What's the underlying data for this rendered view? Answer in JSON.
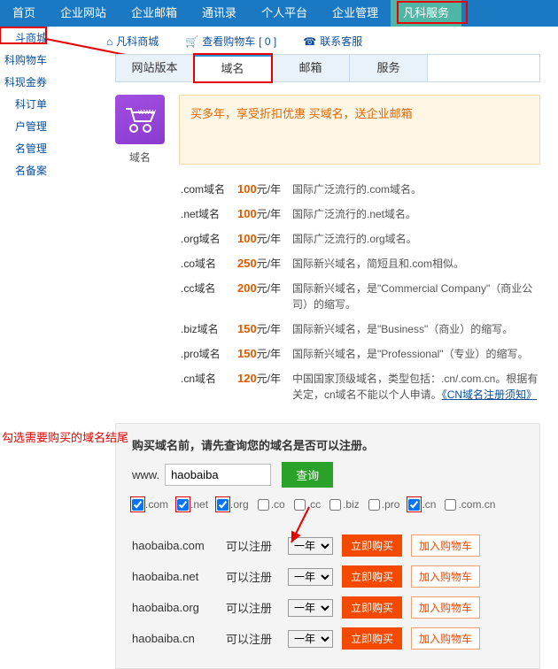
{
  "topnav": {
    "items": [
      "首页",
      "企业网站",
      "企业邮箱",
      "通讯录",
      "个人平台",
      "企业管理",
      "凡科服务"
    ],
    "active_index": 6
  },
  "sidebar": {
    "items": [
      "斗商城",
      "科购物车",
      "科现金券",
      "科订单",
      "户管理",
      "名管理",
      "名备案"
    ],
    "highlight_index": 0
  },
  "subnav": {
    "mall": "凡科商城",
    "cart": "查看购物车",
    "cart_count": "[ 0 ]",
    "service": "联系客服"
  },
  "tabs": {
    "items": [
      "网站版本",
      "域名",
      "邮箱",
      "服务"
    ],
    "active_index": 1
  },
  "domain_icon_label": "域名",
  "promo": "买多年，享受折扣优惠 买域名，送企业邮箱",
  "prices": [
    {
      "ext": ".com域名",
      "price": "100",
      "unit": "元/年",
      "desc": "国际广泛流行的.com域名。"
    },
    {
      "ext": ".net域名",
      "price": "100",
      "unit": "元/年",
      "desc": "国际广泛流行的.net域名。"
    },
    {
      "ext": ".org域名",
      "price": "100",
      "unit": "元/年",
      "desc": "国际广泛流行的.org域名。"
    },
    {
      "ext": ".co域名",
      "price": "250",
      "unit": "元/年",
      "desc": "国际新兴域名，简短且和.com相似。"
    },
    {
      "ext": ".cc域名",
      "price": "200",
      "unit": "元/年",
      "desc": "国际新兴域名，是\"Commercial Company\"（商业公司）的缩写。"
    },
    {
      "ext": ".biz域名",
      "price": "150",
      "unit": "元/年",
      "desc": "国际新兴域名，是\"Business\"（商业）的缩写。"
    },
    {
      "ext": ".pro域名",
      "price": "150",
      "unit": "元/年",
      "desc": "国际新兴域名，是\"Professional\"（专业）的缩写。"
    },
    {
      "ext": ".cn域名",
      "price": "120",
      "unit": "元/年",
      "desc": "中国国家顶级域名，类型包括：.cn/.com.cn。根据有关定，cn域名不能以个人申请。",
      "link": "《CN域名注册须知》"
    }
  ],
  "search": {
    "title": "购买域名前，请先查询您的域名是否可以注册。",
    "www": "www.",
    "value": "haobaiba",
    "button": "查询"
  },
  "tlds": [
    {
      "label": ".com",
      "checked": true,
      "boxed": true
    },
    {
      "label": ".net",
      "checked": true,
      "boxed": true
    },
    {
      "label": ".org",
      "checked": true,
      "boxed": true
    },
    {
      "label": ".co",
      "checked": false,
      "boxed": false
    },
    {
      "label": ".cc",
      "checked": false,
      "boxed": false
    },
    {
      "label": ".biz",
      "checked": false,
      "boxed": false
    },
    {
      "label": ".pro",
      "checked": false,
      "boxed": false
    },
    {
      "label": ".cn",
      "checked": true,
      "boxed": true
    },
    {
      "label": ".com.cn",
      "checked": false,
      "boxed": false
    }
  ],
  "annotation": "勾选需要购买的域名结尾",
  "results": {
    "year_label": "一年",
    "buy": "立即购买",
    "cart": "加入购物车",
    "status": "可以注册",
    "rows": [
      {
        "domain": "haobaiba.com"
      },
      {
        "domain": "haobaiba.net"
      },
      {
        "domain": "haobaiba.org"
      },
      {
        "domain": "haobaiba.cn"
      }
    ]
  }
}
